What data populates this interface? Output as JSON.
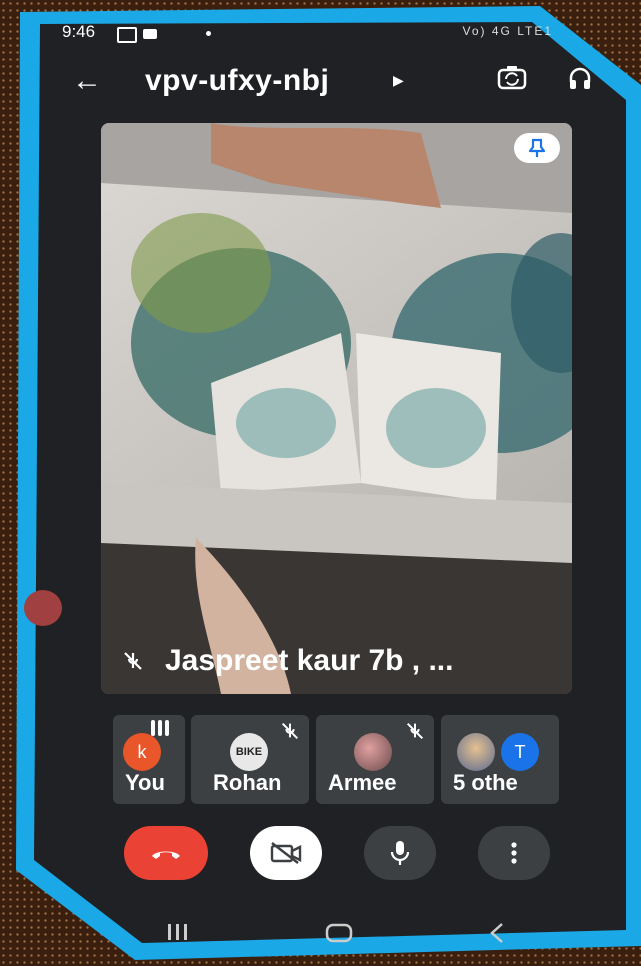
{
  "status_bar": {
    "time": "9:46",
    "indicators": "Vo) 4G LTE1"
  },
  "header": {
    "meeting_code": "vpv-ufxy-nbj",
    "icons": [
      "back-arrow-icon",
      "caret-icon",
      "switch-camera-icon",
      "headphones-icon"
    ]
  },
  "main_video": {
    "participant_label": "Jaspreet kaur 7b , ...",
    "muted": true,
    "pinned": true
  },
  "participants": [
    {
      "label": "You",
      "avatar_letter": "k",
      "avatar_color": "#e8562a",
      "speaking": true
    },
    {
      "label": "Rohan",
      "avatar_text": "BIKE",
      "muted": true
    },
    {
      "label": "Armee",
      "muted": true
    },
    {
      "label": "5 othe",
      "avatar_letter": "T",
      "avatar_color": "#1a73e8"
    }
  ],
  "controls": {
    "end_call_color": "#ea4335",
    "camera_off": true,
    "icons": [
      "end-call-icon",
      "camera-off-icon",
      "mic-icon",
      "more-vert-icon"
    ]
  },
  "colors": {
    "frame": "#1aa8e6",
    "app_bg": "#202124",
    "tile_bg": "#3c4043"
  }
}
